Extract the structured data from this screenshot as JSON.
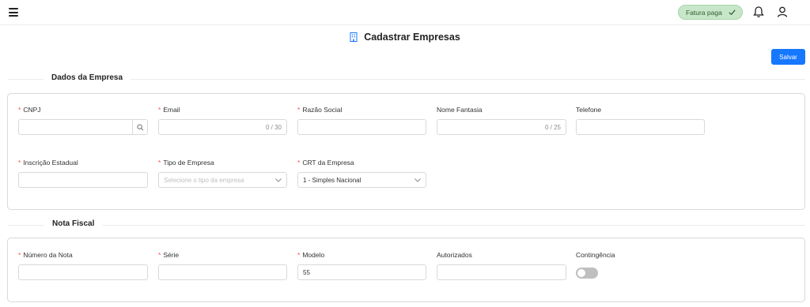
{
  "header": {
    "badge_label": "Fatura paga",
    "icons": [
      "menu-icon",
      "check-icon",
      "bell-icon",
      "user-icon"
    ]
  },
  "page": {
    "title": "Cadastrar Empresas",
    "title_icon": "building-icon",
    "save_label": "Salvar"
  },
  "section_company": {
    "title": "Dados da Empresa",
    "fields": {
      "cnpj": {
        "label": "CNPJ",
        "required": true,
        "value": ""
      },
      "email": {
        "label": "Email",
        "required": true,
        "value": "",
        "counter": "0 / 30"
      },
      "razao_social": {
        "label": "Razão Social",
        "required": true,
        "value": ""
      },
      "nome_fantasia": {
        "label": "Nome Fantasia",
        "required": false,
        "value": "",
        "counter": "0 / 25"
      },
      "telefone": {
        "label": "Telefone",
        "required": false,
        "value": ""
      },
      "inscricao_estadual": {
        "label": "Inscrição Estadual",
        "required": true,
        "value": ""
      },
      "tipo_empresa": {
        "label": "Tipo de Empresa",
        "required": true,
        "placeholder": "Selecione o tipo da empresa"
      },
      "crt_empresa": {
        "label": "CRT da Empresa",
        "required": true,
        "value": "1 - Simples Nacional"
      }
    }
  },
  "section_invoice": {
    "title": "Nota Fiscal",
    "fields": {
      "numero_nota": {
        "label": "Número da Nota",
        "required": true,
        "value": ""
      },
      "serie": {
        "label": "Série",
        "required": true,
        "value": ""
      },
      "modelo": {
        "label": "Modelo",
        "required": true,
        "value": "55"
      },
      "autorizados": {
        "label": "Autorizados",
        "required": false,
        "value": ""
      },
      "contingencia": {
        "label": "Contingência",
        "required": false,
        "enabled": false
      }
    }
  },
  "colors": {
    "primary": "#1677ff",
    "required": "#ff4d4f",
    "badge_bg": "#c8e6c9",
    "toggle_off": "#bfbfbf"
  }
}
